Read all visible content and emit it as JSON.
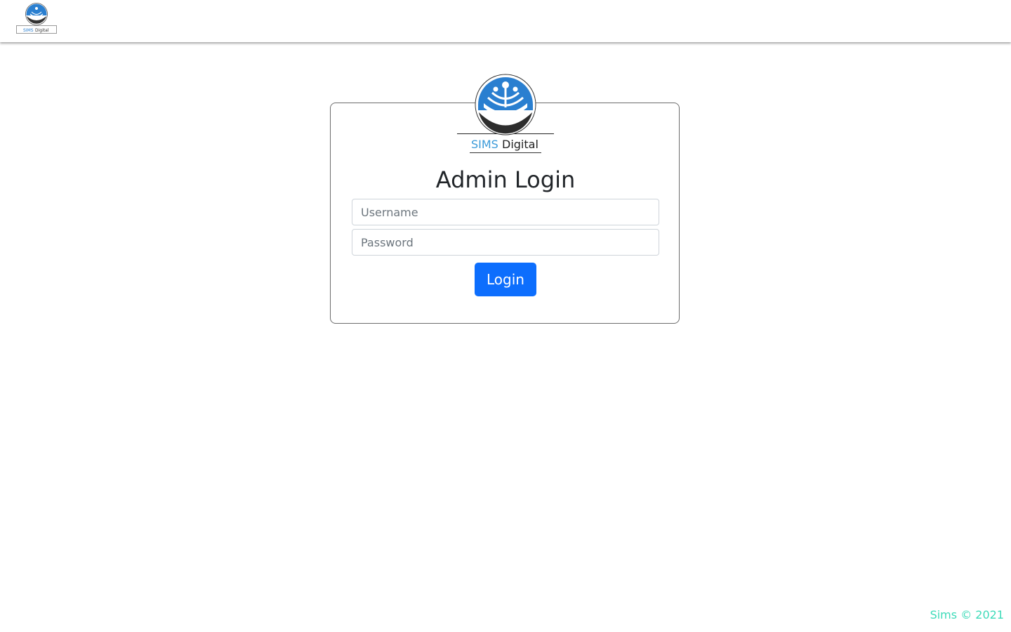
{
  "header": {
    "logo_text": "SIMS Digital"
  },
  "login": {
    "logo_text_sims": "SIMS",
    "logo_text_digital": "Digital",
    "title": "Admin Login",
    "username_placeholder": "Username",
    "password_placeholder": "Password",
    "submit_label": "Login"
  },
  "footer": {
    "text": "Sims © 2021"
  },
  "colors": {
    "primary": "#0d6efd",
    "footer_text": "#3ddbb9",
    "logo_blue": "#2a7fd0"
  }
}
